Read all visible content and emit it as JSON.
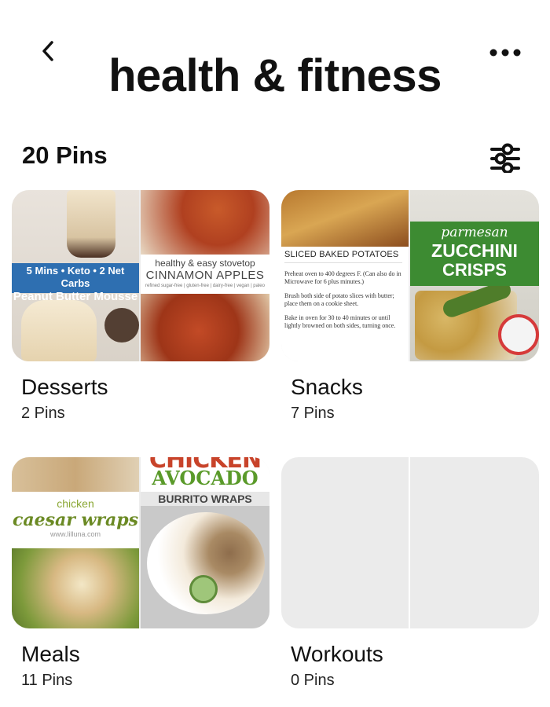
{
  "header": {
    "title": "health & fitness"
  },
  "summary": {
    "pins_count": "20 Pins"
  },
  "boards": [
    {
      "name": "Desserts",
      "count": "2 Pins",
      "cover_left": {
        "line1": "5 Mins • Keto • 2 Net Carbs",
        "line2": "Peanut Butter Mousse"
      },
      "cover_right": {
        "line1": "healthy & easy stovetop",
        "line2": "CINNAMON APPLES",
        "line3": "refined sugar-free | gluten-free | dairy-free | vegan | paleo"
      }
    },
    {
      "name": "Snacks",
      "count": "7 Pins",
      "cover_left": {
        "title": "SLICED BAKED POTATOES",
        "p1": "Preheat oven to 400 degrees F. (Can also do in Microwave for 6 plus minutes.)",
        "p2": "Brush both side of potato slices with butter; place them on a cookie sheet.",
        "p3": "Bake in oven for 30 to 40 minutes or until lightly browned on both sides, turning once."
      },
      "cover_right": {
        "line1": "parmesan",
        "line2": "ZUCCHINI",
        "line3": "CRISPS"
      }
    },
    {
      "name": "Meals",
      "count": "11 Pins",
      "cover_left": {
        "line1": "chicken",
        "line2": "caesar wraps",
        "line3": "www.lilluna.com"
      },
      "cover_right": {
        "line1": "CHICKEN",
        "line2": "AVOCADO",
        "line3": "BURRITO WRAPS"
      }
    },
    {
      "name": "Workouts",
      "count": "0 Pins"
    }
  ]
}
